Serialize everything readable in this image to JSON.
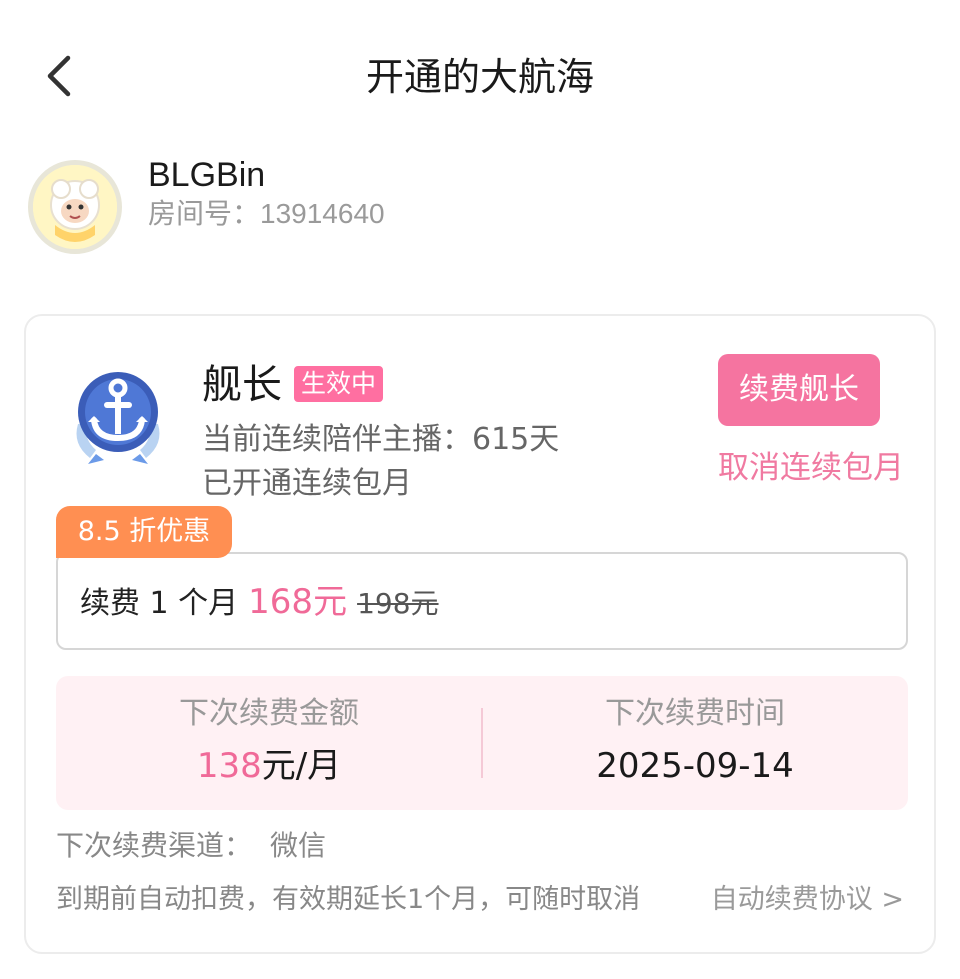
{
  "header": {
    "title": "开通的大航海"
  },
  "user": {
    "name": "BLGBin",
    "room_label": "房间号：",
    "room_number": "13914640"
  },
  "membership": {
    "tier_name": "舰长",
    "status": "生效中",
    "companion_text": "当前连续陪伴主播：615天",
    "monthly_text": "已开通连续包月",
    "renew_button": "续费舰长",
    "cancel_link": "取消连续包月",
    "discount_tag": "8.5 折优惠",
    "price": {
      "prefix": "续费  1  个月",
      "current": "168元",
      "original": "198元"
    },
    "next": {
      "amount_label": "下次续费金额",
      "amount_value": "138",
      "amount_unit": "元/月",
      "time_label": "下次续费时间",
      "time_value": "2025-09-14"
    },
    "channel_label": "下次续费渠道：",
    "channel_value": "微信",
    "auto_note": "到期前自动扣费，有效期延长1个月，可随时取消",
    "agreement_link": "自动续费协议 >"
  },
  "colors": {
    "accent_pink": "#f574a0",
    "discount_orange": "#ff8f52",
    "panel_bg": "#fff1f4"
  },
  "icons": [
    "back-arrow-icon",
    "anchor-badge-icon",
    "avatar-sheep"
  ]
}
